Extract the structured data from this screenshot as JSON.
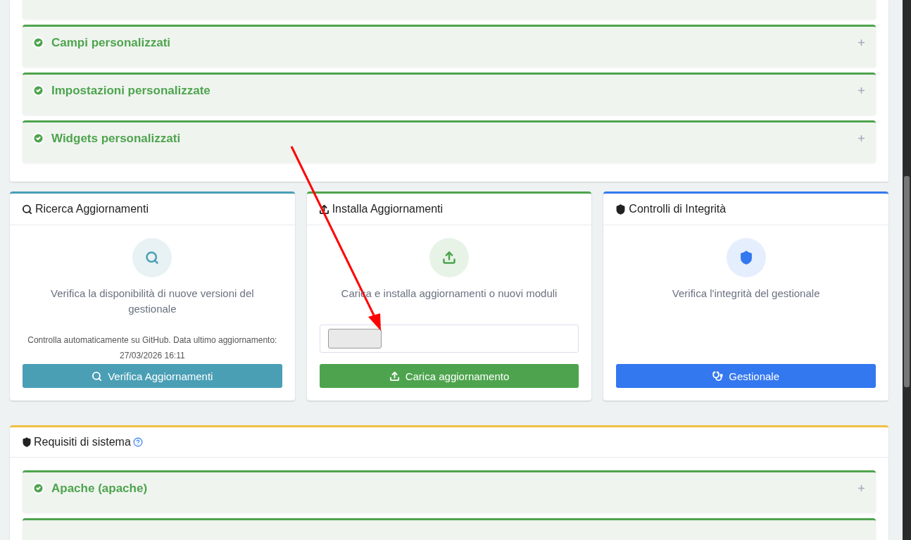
{
  "custom_sections": [
    {
      "title": "Campi personalizzati",
      "expanded": false
    },
    {
      "title": "Impostazioni personalizzate",
      "expanded": false
    },
    {
      "title": "Widgets personalizzati",
      "expanded": false
    }
  ],
  "cards": [
    {
      "kind": "search",
      "color": "#4a9fb5",
      "title": "Ricerca Aggiornamenti",
      "description": "Verifica la disponibilità di nuove versioni del gestionale",
      "note": "Controlla automaticamente su GitHub. Data ultimo aggiornamento: 27/03/2026 16:11",
      "button": "Verifica Aggiornamenti"
    },
    {
      "kind": "upload",
      "color": "#4ea44e",
      "title": "Installa Aggiornamenti",
      "description": "Carica e installa aggiornamenti o nuovi moduli",
      "button": "Carica aggiornamento"
    },
    {
      "kind": "integrity",
      "color": "#3478f0",
      "title": "Controlli di Integrità",
      "description": "Verifica l'integrità del gestionale",
      "button": "Gestionale"
    }
  ],
  "requirements": {
    "title": "Requisiti di sistema",
    "items": [
      {
        "title": "Apache (apache)",
        "expanded": false
      }
    ]
  }
}
